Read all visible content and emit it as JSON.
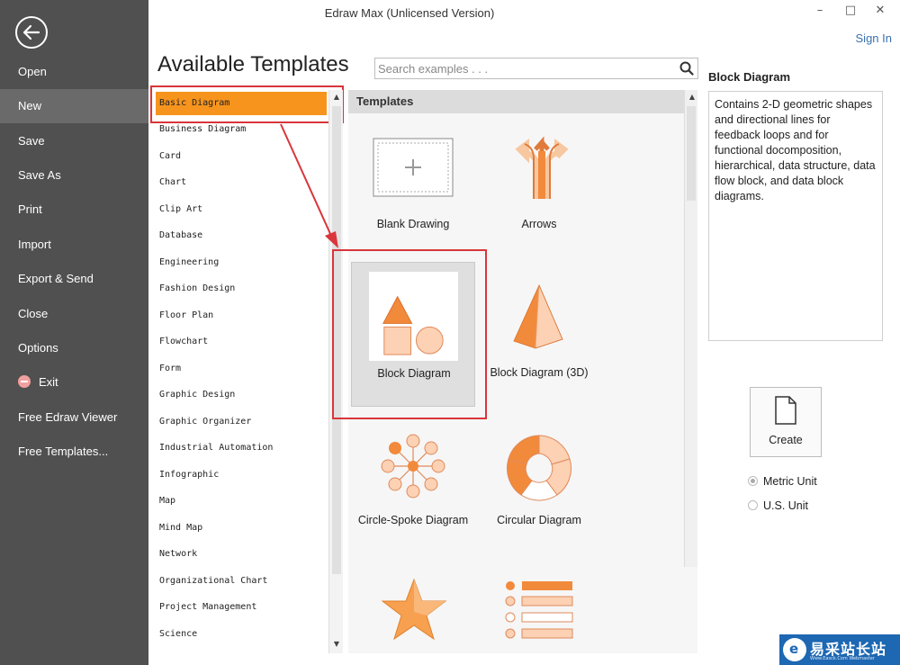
{
  "window": {
    "title": "Edraw Max (Unlicensed Version)",
    "minimize": "–",
    "maximize": "□",
    "close": "✕",
    "sign_in": "Sign In"
  },
  "sidebar": {
    "back_icon": "back-arrow-icon",
    "items": [
      {
        "label": "Open"
      },
      {
        "label": "New"
      },
      {
        "label": "Save"
      },
      {
        "label": "Save As"
      },
      {
        "label": "Print"
      },
      {
        "label": "Import"
      },
      {
        "label": "Export & Send"
      },
      {
        "label": "Close"
      },
      {
        "label": "Options"
      },
      {
        "label": "Exit"
      },
      {
        "label": "Free Edraw Viewer"
      },
      {
        "label": "Free Templates..."
      }
    ],
    "active": "New"
  },
  "main": {
    "title": "Available Templates",
    "search_placeholder": "Search examples . . .",
    "categories": [
      "Basic Diagram",
      "Business Diagram",
      "Card",
      "Chart",
      "Clip Art",
      "Database",
      "Engineering",
      "Fashion Design",
      "Floor Plan",
      "Flowchart",
      "Form",
      "Graphic Design",
      "Graphic Organizer",
      "Industrial Automation",
      "Infographic",
      "Map",
      "Mind Map",
      "Network",
      "Organizational Chart",
      "Project Management",
      "Science"
    ],
    "selected_category": "Basic Diagram",
    "templates_header": "Templates",
    "templates": [
      {
        "label": "Blank Drawing"
      },
      {
        "label": "Arrows"
      },
      {
        "label": "Block Diagram"
      },
      {
        "label": "Block Diagram (3D)"
      },
      {
        "label": "Circle-Spoke Diagram"
      },
      {
        "label": "Circular Diagram"
      }
    ],
    "selected_template": "Block Diagram"
  },
  "details": {
    "title": "Block Diagram",
    "description": "Contains 2-D geometric shapes and directional lines for feedback loops and for functional docomposition, hierarchical, data structure, data flow block, and data block diagrams.",
    "create_label": "Create",
    "units": [
      {
        "label": "Metric Unit",
        "checked": true
      },
      {
        "label": "U.S. Unit",
        "checked": false
      }
    ]
  },
  "colors": {
    "sidebar": "#505050",
    "accent_orange": "#f7941d",
    "highlight_red": "#d9353a",
    "link_blue": "#3a6fb0"
  },
  "watermark": {
    "text": "易采站长站",
    "sub": "Www.Easck.Com Webmaster"
  }
}
